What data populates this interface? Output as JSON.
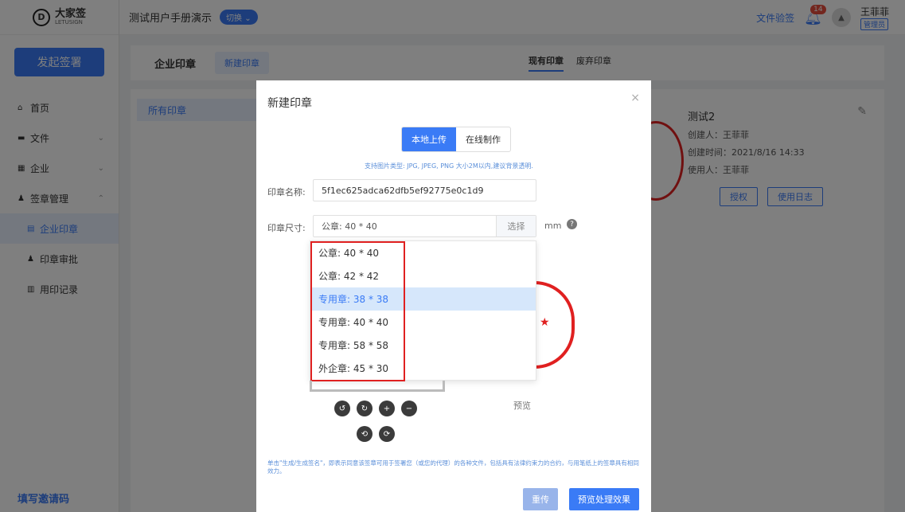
{
  "app": {
    "logo_text": "大家签",
    "logo_sub": "LETUSIGN",
    "workspace": "测试用户手册演示",
    "switch_label": "切换",
    "doc_verify": "文件验签",
    "notif_count": "14",
    "user_name": "王菲菲",
    "user_role": "管理员"
  },
  "sidebar": {
    "launch": "发起签署",
    "items": [
      {
        "label": "首页"
      },
      {
        "label": "文件"
      },
      {
        "label": "企业"
      },
      {
        "label": "签章管理"
      },
      {
        "label": "企业印章"
      },
      {
        "label": "印章审批"
      },
      {
        "label": "用印记录"
      }
    ],
    "invite": "填写邀请码"
  },
  "page": {
    "title": "企业印章",
    "new_seal": "新建印章",
    "tab_current": "现有印章",
    "tab_abandoned": "废弃印章",
    "all_seals": "所有印章"
  },
  "card": {
    "title": "测试2",
    "creator": "创建人：王菲菲",
    "created_time": "创建时间：2021/8/16 14:33",
    "user": "使用人：王菲菲",
    "authorize": "授权",
    "usage_log": "使用日志"
  },
  "modal": {
    "title": "新建印章",
    "tab_local": "本地上传",
    "tab_online": "在线制作",
    "hint": "支持图片类型: JPG, JPEG, PNG 大小2M以内,建议背景透明.",
    "name_label": "印章名称:",
    "name_value": "5f1ec625adca62dfb5ef92775e0c1d9",
    "size_label": "印章尺寸:",
    "size_value": "公章: 40 * 40",
    "select_btn": "选择",
    "unit": "mm",
    "size_options": [
      {
        "label": "公章: 40 * 40"
      },
      {
        "label": "公章: 42 * 42"
      },
      {
        "label": "专用章: 38 * 38"
      },
      {
        "label": "专用章: 40 * 40"
      },
      {
        "label": "专用章: 58 * 58"
      },
      {
        "label": "外企章: 45 * 30"
      }
    ],
    "preview_label": "预览",
    "disclaimer": "单击\"生成/生成签名\"，即表示同意该签章可用于签署您（或您的代理）的各种文件，包括具有法律约束力的合约，与用笔纸上的签章具有相同效力。",
    "reupload": "重传",
    "preview_effect": "预览处理效果"
  }
}
